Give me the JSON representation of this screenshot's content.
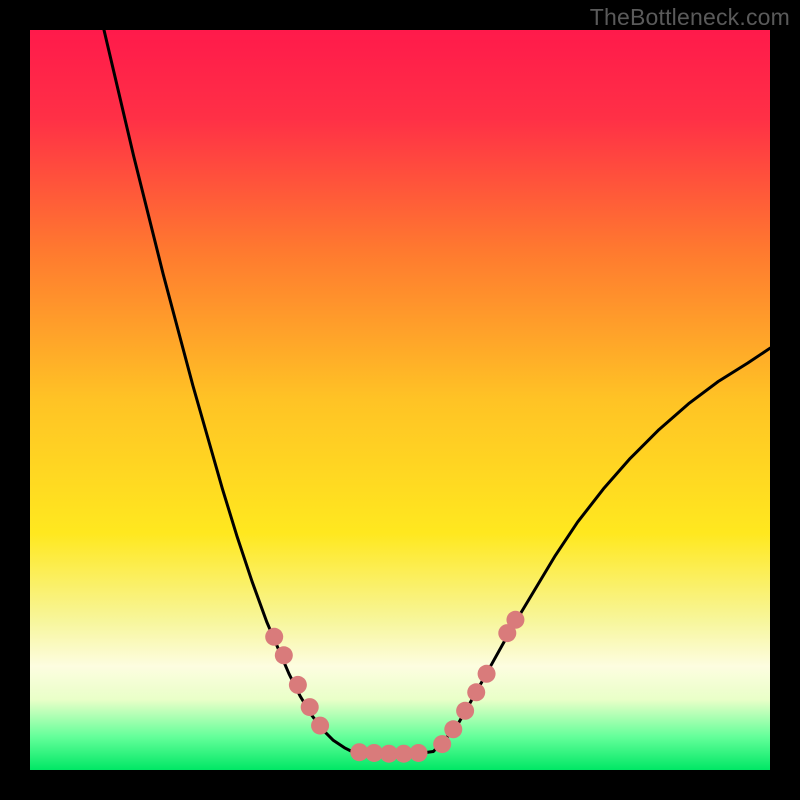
{
  "watermark": "TheBottleneck.com",
  "chart_data": {
    "type": "line",
    "title": "",
    "xlabel": "",
    "ylabel": "",
    "xlim": [
      0,
      100
    ],
    "ylim": [
      0,
      100
    ],
    "grid": false,
    "legend": false,
    "background_gradient_stops": [
      {
        "offset": 0.0,
        "color": "#ff1a4b"
      },
      {
        "offset": 0.12,
        "color": "#ff3046"
      },
      {
        "offset": 0.3,
        "color": "#ff7a2f"
      },
      {
        "offset": 0.5,
        "color": "#ffc325"
      },
      {
        "offset": 0.68,
        "color": "#ffe81f"
      },
      {
        "offset": 0.8,
        "color": "#f7f69d"
      },
      {
        "offset": 0.86,
        "color": "#fdfde0"
      },
      {
        "offset": 0.905,
        "color": "#e9ffc8"
      },
      {
        "offset": 0.955,
        "color": "#64ff9a"
      },
      {
        "offset": 1.0,
        "color": "#00e765"
      }
    ],
    "series": [
      {
        "name": "left-curve",
        "stroke": "#000000",
        "x": [
          10.0,
          12.0,
          14.0,
          16.0,
          18.0,
          20.0,
          22.0,
          24.0,
          26.0,
          28.0,
          30.0,
          32.0,
          33.5,
          35.0,
          36.5,
          38.0,
          39.5,
          41.0,
          42.5,
          43.5
        ],
        "y": [
          100.0,
          91.5,
          83.0,
          75.0,
          67.0,
          59.5,
          52.0,
          45.0,
          38.0,
          31.5,
          25.5,
          20.0,
          16.5,
          13.0,
          10.0,
          7.5,
          5.5,
          4.0,
          3.0,
          2.5
        ]
      },
      {
        "name": "flat-bottom",
        "stroke": "#000000",
        "x": [
          43.5,
          45.0,
          47.0,
          49.0,
          51.0,
          53.0,
          54.5
        ],
        "y": [
          2.5,
          2.3,
          2.2,
          2.2,
          2.2,
          2.3,
          2.5
        ]
      },
      {
        "name": "right-curve",
        "stroke": "#000000",
        "x": [
          54.5,
          56.0,
          58.0,
          60.0,
          62.5,
          65.0,
          68.0,
          71.0,
          74.0,
          77.5,
          81.0,
          85.0,
          89.0,
          93.0,
          97.0,
          100.0
        ],
        "y": [
          2.5,
          4.0,
          6.5,
          10.0,
          14.5,
          19.0,
          24.0,
          29.0,
          33.5,
          38.0,
          42.0,
          46.0,
          49.5,
          52.5,
          55.0,
          57.0
        ]
      }
    ],
    "markers": {
      "name": "threshold-dots",
      "fill": "#d97b7b",
      "radius": 9,
      "points": [
        {
          "x": 33.0,
          "y": 18.0
        },
        {
          "x": 34.3,
          "y": 15.5
        },
        {
          "x": 36.2,
          "y": 11.5
        },
        {
          "x": 37.8,
          "y": 8.5
        },
        {
          "x": 39.2,
          "y": 6.0
        },
        {
          "x": 44.5,
          "y": 2.4
        },
        {
          "x": 46.5,
          "y": 2.3
        },
        {
          "x": 48.5,
          "y": 2.2
        },
        {
          "x": 50.5,
          "y": 2.2
        },
        {
          "x": 52.5,
          "y": 2.3
        },
        {
          "x": 55.7,
          "y": 3.5
        },
        {
          "x": 57.2,
          "y": 5.5
        },
        {
          "x": 58.8,
          "y": 8.0
        },
        {
          "x": 60.3,
          "y": 10.5
        },
        {
          "x": 61.7,
          "y": 13.0
        },
        {
          "x": 64.5,
          "y": 18.5
        },
        {
          "x": 65.6,
          "y": 20.3
        }
      ]
    }
  }
}
